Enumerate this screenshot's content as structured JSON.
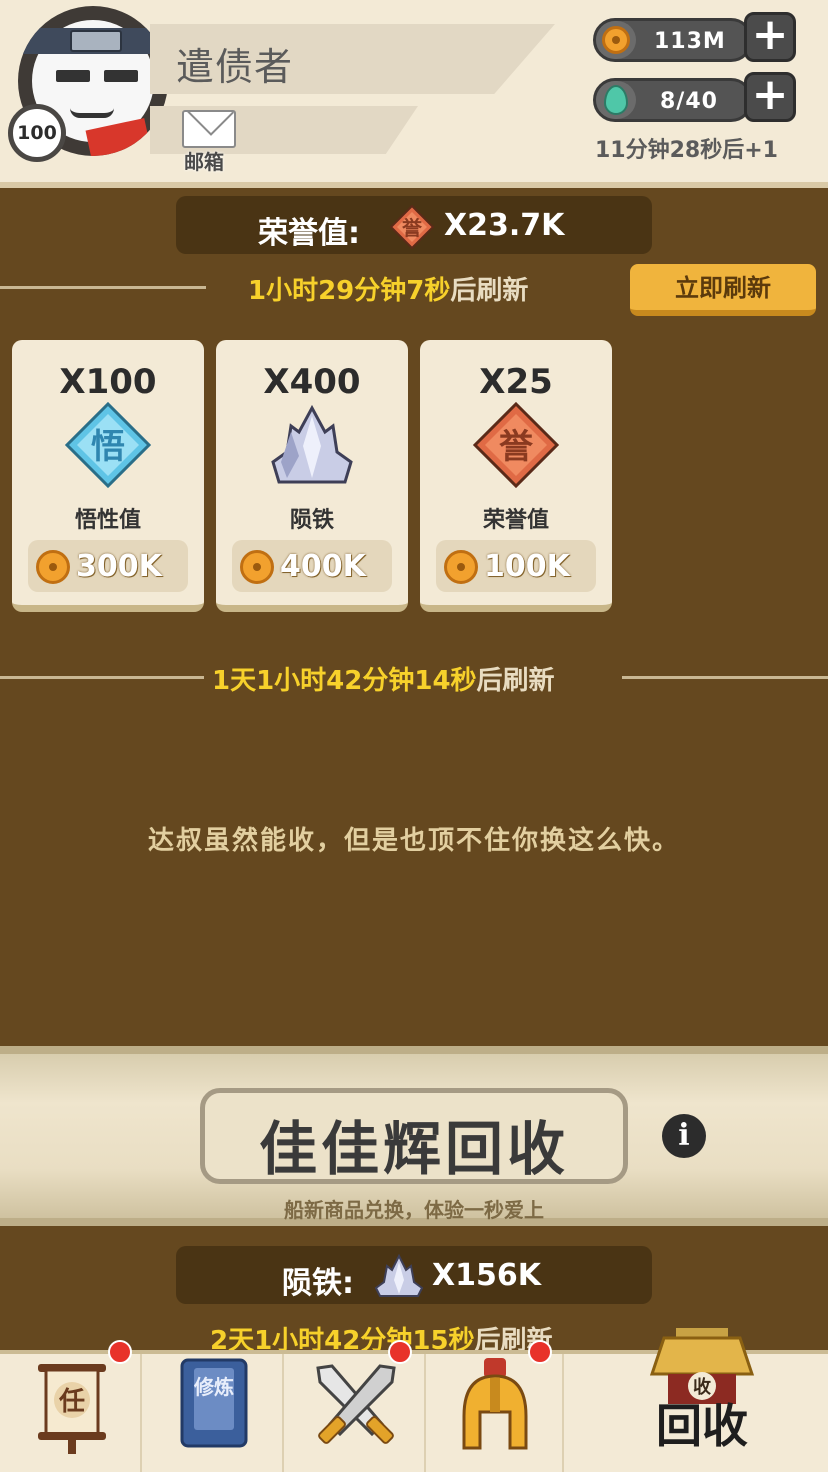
{
  "player": {
    "name": "遣债者",
    "level": "100",
    "mail_label": "邮箱"
  },
  "resources": {
    "coins": "113M",
    "energy": "8/40",
    "energy_timer": "11分钟28秒后+1"
  },
  "honor": {
    "label": "荣誉值:",
    "value": "X23.7K",
    "icon_char": "誉"
  },
  "shop_refresh": {
    "countdown": "1小时29分钟7秒",
    "suffix": "后刷新",
    "button_label": "立即刷新"
  },
  "shop_items": [
    {
      "quantity": "X100",
      "icon": "wuxing-icon",
      "icon_char": "悟",
      "name": "悟性值",
      "price": "300K"
    },
    {
      "quantity": "X400",
      "icon": "meteorite-icon",
      "name": "陨铁",
      "price": "400K"
    },
    {
      "quantity": "X25",
      "icon": "honor-icon",
      "icon_char": "誉",
      "name": "荣誉值",
      "price": "100K"
    }
  ],
  "second_refresh": {
    "countdown": "1天1小时42分钟14秒",
    "suffix": "后刷新"
  },
  "dialog": "达叔虽然能收，但是也顶不住你换这么快。",
  "banner": {
    "title": "佳佳辉回收",
    "subtitle": "船新商品兑换，体验一秒爱上"
  },
  "meteor": {
    "label": "陨铁:",
    "value": "X156K"
  },
  "third_refresh": {
    "countdown": "2天1小时42分钟15秒",
    "suffix": "后刷新"
  },
  "nav": {
    "task_char": "任",
    "book_chars": "修炼",
    "recycle_char": "收",
    "recycle_label": "回收"
  },
  "colors": {
    "background": "#65481f",
    "panel": "#f3ead6",
    "accent_yellow": "#f7d12b",
    "button_orange": "#f0b43d",
    "badge_red": "#e8322a"
  }
}
